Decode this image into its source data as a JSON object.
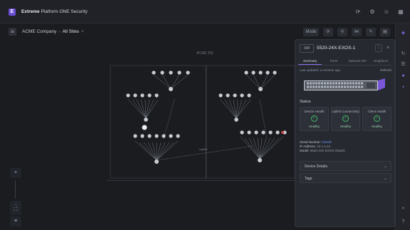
{
  "topbar": {
    "logo_letter": "E",
    "brand": "Extreme",
    "title_rest": "Platform ONE Security",
    "icons": [
      "refresh-icon",
      "settings-icon",
      "user-icon",
      "apps-grid-icon"
    ]
  },
  "breadcrumb": {
    "org": "ACME Company",
    "site": "All Sites",
    "plus": "+"
  },
  "toolbar": {
    "select_label": "Mode",
    "buttons": [
      "refresh-icon",
      "filter-icon",
      "layout-icon",
      "edit-icon",
      "export-icon"
    ]
  },
  "topology": {
    "region_label": "ACME HQ",
    "link_label": "Uplink"
  },
  "panel": {
    "chip_label": "SW",
    "title": "5520-24X-EXOS-1",
    "tabs": [
      "Summary",
      "Ports",
      "Network Info",
      "Neighbors"
    ],
    "meta_left": "Last updated: a moment ago",
    "meta_right": "Refresh",
    "status_title": "Status",
    "status_cards": [
      {
        "label": "Device Health",
        "value": "Healthy"
      },
      {
        "label": "Uplink Connectivity",
        "value": "Healthy"
      },
      {
        "label": "Client Health",
        "value": "Healthy"
      }
    ],
    "info": [
      {
        "key": "Serial Number:",
        "value": "Details",
        "link": true
      },
      {
        "key": "IP Address:",
        "value": "10.1.1.24"
      },
      {
        "key": "Model:",
        "value": "5520-24X-EXOS (Stack)"
      }
    ],
    "accordions": [
      "Device Details",
      "Tags"
    ]
  },
  "left_controls": {
    "zoom_in": "+",
    "zoom_out": "−",
    "fit": "⛶",
    "legend": "≡"
  }
}
